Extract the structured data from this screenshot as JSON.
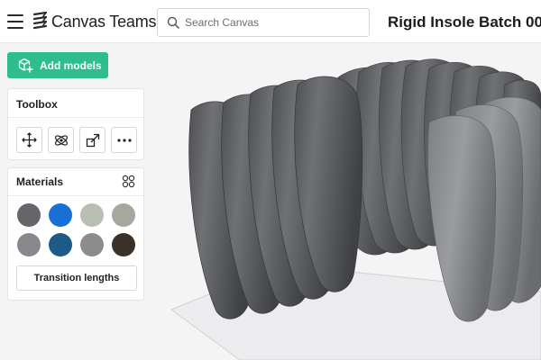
{
  "app": {
    "name": "Canvas Teams",
    "document_title": "Rigid Insole Batch 00..."
  },
  "search": {
    "placeholder": "Search Canvas",
    "value": ""
  },
  "actions": {
    "add_models_label": "Add models"
  },
  "toolbox": {
    "title": "Toolbox",
    "tools": [
      {
        "icon": "move-icon"
      },
      {
        "icon": "rotate-icon"
      },
      {
        "icon": "scale-icon"
      },
      {
        "icon": "more-icon"
      }
    ]
  },
  "materials": {
    "title": "Materials",
    "grid_icon": "grid-icon",
    "swatches": [
      {
        "color": "#646669"
      },
      {
        "color": "#1a6fd4"
      },
      {
        "color": "#b6bfb1"
      },
      {
        "color": "#a8a79f"
      },
      {
        "color": "#8a878c"
      },
      {
        "color": "#1e5a87"
      },
      {
        "color": "#8b8c8d"
      },
      {
        "color": "#3a3128"
      }
    ],
    "transition_label": "Transition lengths"
  },
  "colors": {
    "accent": "#2dbd8f",
    "insole": "#6d6f72"
  }
}
